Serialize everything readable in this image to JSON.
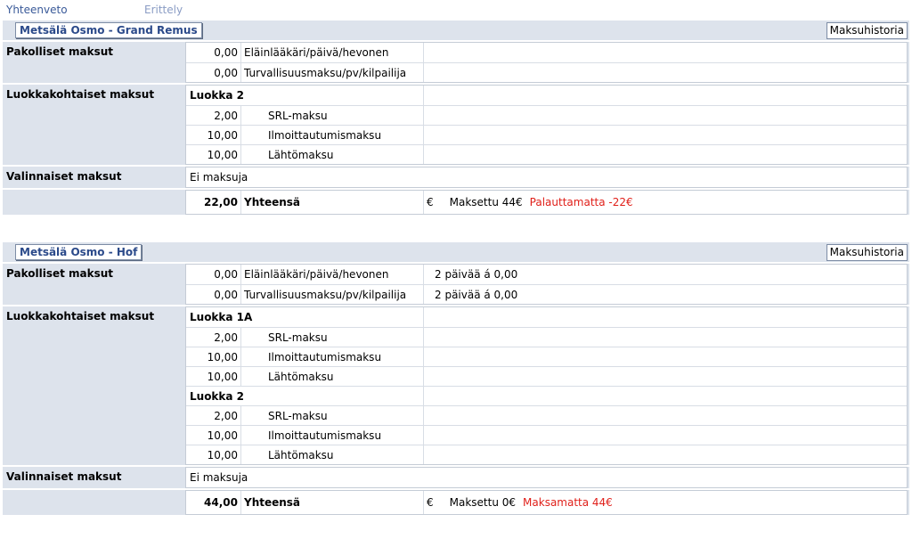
{
  "tabs": {
    "summary": "Yhteenveto",
    "detail": "Erittely"
  },
  "labels": {
    "mandatory": "Pakolliset maksut",
    "class_fees": "Luokkakohtaiset maksut",
    "optional": "Valinnaiset maksut",
    "history": "Maksuhistoria",
    "total": "Yhteensä",
    "no_fees": "Ei maksuja",
    "currency": "€"
  },
  "blocks": [
    {
      "horse": "Metsälä Osmo - Grand Remus",
      "mandatory": [
        {
          "amount": "0,00",
          "desc": "Eläinlääkäri/päivä/hevonen",
          "note": ""
        },
        {
          "amount": "0,00",
          "desc": "Turvallisuusmaksu/pv/kilpailija",
          "note": ""
        }
      ],
      "classes": [
        {
          "name": "Luokka 2",
          "fees": [
            {
              "amount": "2,00",
              "desc": "SRL-maksu"
            },
            {
              "amount": "10,00",
              "desc": "Ilmoittautumismaksu"
            },
            {
              "amount": "10,00",
              "desc": "Lähtömaksu"
            }
          ]
        }
      ],
      "total": "22,00",
      "paid": "Maksettu 44€",
      "balance": "Palauttamatta -22€"
    },
    {
      "horse": "Metsälä Osmo - Hof",
      "mandatory": [
        {
          "amount": "0,00",
          "desc": "Eläinlääkäri/päivä/hevonen",
          "note": "2 päivää á 0,00"
        },
        {
          "amount": "0,00",
          "desc": "Turvallisuusmaksu/pv/kilpailija",
          "note": "2 päivää á 0,00"
        }
      ],
      "classes": [
        {
          "name": "Luokka 1A",
          "fees": [
            {
              "amount": "2,00",
              "desc": "SRL-maksu"
            },
            {
              "amount": "10,00",
              "desc": "Ilmoittautumismaksu"
            },
            {
              "amount": "10,00",
              "desc": "Lähtömaksu"
            }
          ]
        },
        {
          "name": "Luokka 2",
          "fees": [
            {
              "amount": "2,00",
              "desc": "SRL-maksu"
            },
            {
              "amount": "10,00",
              "desc": "Ilmoittautumismaksu"
            },
            {
              "amount": "10,00",
              "desc": "Lähtömaksu"
            }
          ]
        }
      ],
      "total": "44,00",
      "paid": "Maksettu 0€",
      "balance": "Maksamatta 44€"
    }
  ],
  "colors": {
    "accent": "#2b4a8a",
    "section_bg": "#dde3ec",
    "alert": "#e0201a"
  }
}
